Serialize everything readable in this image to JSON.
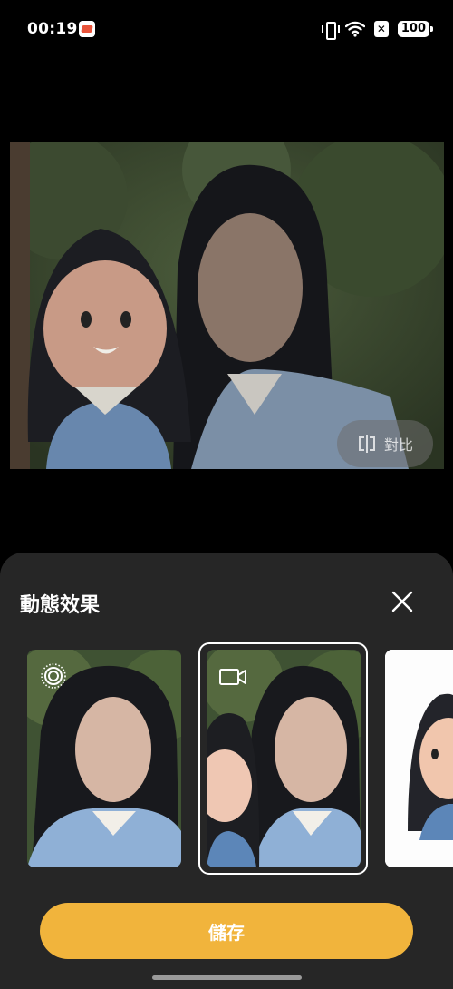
{
  "status_bar": {
    "time": "00:19",
    "battery": "100",
    "icons": [
      "app-notification-icon",
      "vibrate-icon",
      "wifi-icon",
      "no-sim-icon",
      "battery-icon"
    ]
  },
  "photo": {
    "compare_label": "對比",
    "compare_icon": "compare-split-icon"
  },
  "sheet": {
    "title": "動態效果",
    "close_icon": "close-icon",
    "effects": [
      {
        "icon": "live-photo-icon",
        "selected": false
      },
      {
        "icon": "video-camera-icon",
        "selected": true
      },
      {
        "icon": "",
        "selected": false
      }
    ],
    "save_label": "儲存"
  },
  "colors": {
    "accent": "#f1b43c",
    "sheet_bg": "#262626",
    "background": "#000000"
  }
}
